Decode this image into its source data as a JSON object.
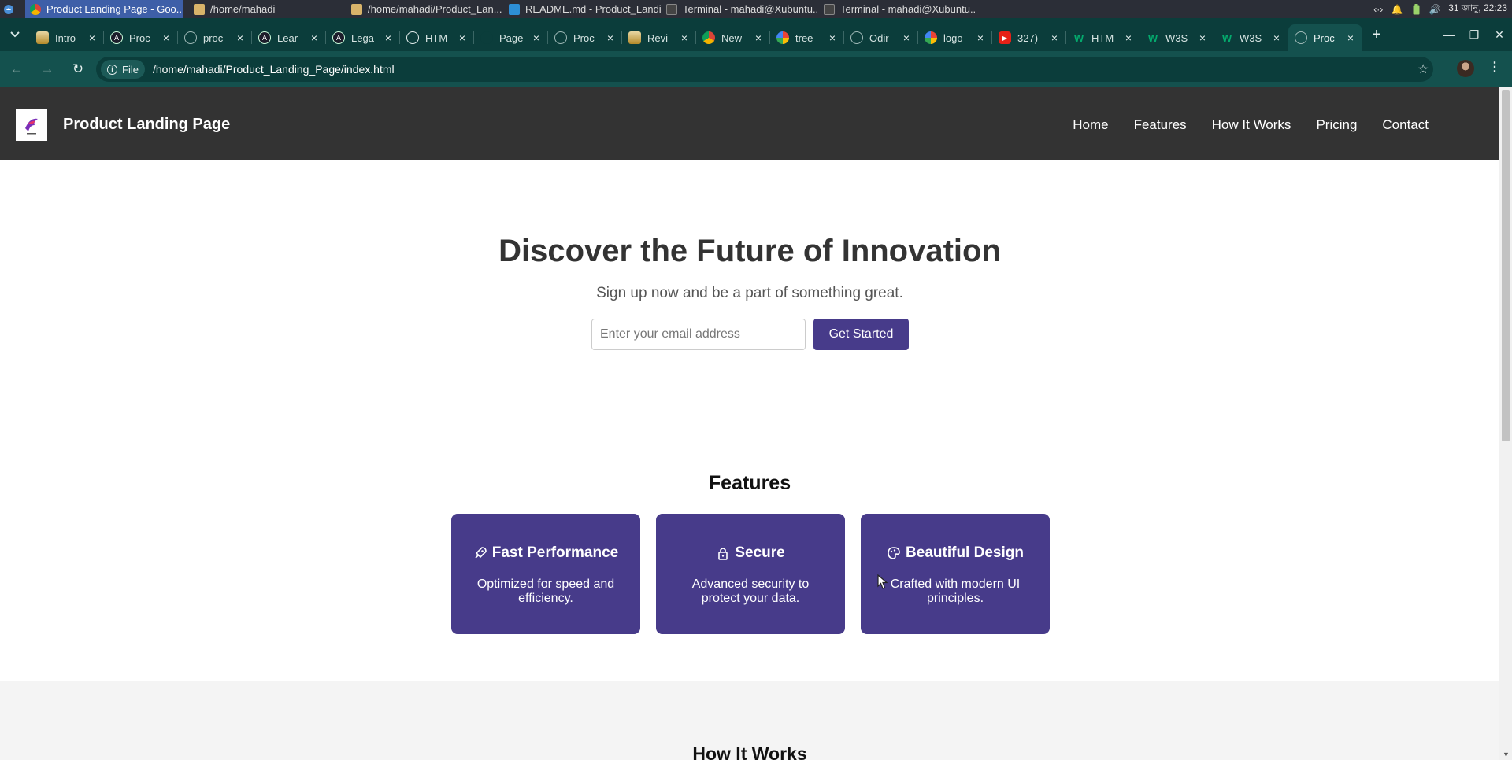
{
  "taskbar": {
    "windows": [
      {
        "label": "Product Landing Page - Goo...",
        "icon": "chrome-icon",
        "active": true
      },
      {
        "label": "/home/mahadi",
        "icon": "folder-icon"
      },
      {
        "label": "/home/mahadi/Product_Lan...",
        "icon": "folder-icon"
      },
      {
        "label": "README.md - Product_Landi...",
        "icon": "vscode-icon"
      },
      {
        "label": "Terminal - mahadi@Xubuntu...",
        "icon": "terminal-icon"
      },
      {
        "label": "Terminal - mahadi@Xubuntu...",
        "icon": "terminal-icon"
      }
    ],
    "clock": "31 জানু, 22:23"
  },
  "tabs": [
    {
      "label": "Intro",
      "icon": "odin-icon",
      "color": "#c9a227"
    },
    {
      "label": "Proc",
      "icon": "angular-icon",
      "color": "#1d1d2b"
    },
    {
      "label": "proc",
      "icon": "globe-icon",
      "color": "#5b7b79"
    },
    {
      "label": "Lear",
      "icon": "angular-icon",
      "color": "#1d1d2b"
    },
    {
      "label": "Lega",
      "icon": "angular-icon",
      "color": "#1d1d2b"
    },
    {
      "label": "HTM",
      "icon": "openai-icon",
      "color": "#1d1d2b"
    },
    {
      "label": "Page",
      "icon": "blank-icon",
      "color": "#0b3d3b"
    },
    {
      "label": "Proc",
      "icon": "globe-icon",
      "color": "#5b7b79"
    },
    {
      "label": "Revi",
      "icon": "odin-icon",
      "color": "#c9a227"
    },
    {
      "label": "New",
      "icon": "chrome-icon",
      "color": "#2f2f2f"
    },
    {
      "label": "tree",
      "icon": "google-icon",
      "color": "#ffffff"
    },
    {
      "label": "Odir",
      "icon": "globe-icon",
      "color": "#5b7b79"
    },
    {
      "label": "logo",
      "icon": "google-icon",
      "color": "#ffffff"
    },
    {
      "label": "327)",
      "icon": "youtube-icon",
      "color": "#e62117"
    },
    {
      "label": "HTM",
      "icon": "w3schools-icon",
      "color": "#04aa6d"
    },
    {
      "label": "W3S",
      "icon": "w3schools-icon",
      "color": "#04aa6d"
    },
    {
      "label": "W3S",
      "icon": "w3schools-icon",
      "color": "#04aa6d"
    },
    {
      "label": "Proc",
      "icon": "globe-icon",
      "color": "#5b7b79",
      "active": true
    }
  ],
  "toolbar": {
    "scheme_chip": "File",
    "url": "/home/mahadi/Product_Landing_Page/index.html"
  },
  "page": {
    "site_title": "Product Landing Page",
    "nav": [
      "Home",
      "Features",
      "How It Works",
      "Pricing",
      "Contact"
    ],
    "hero": {
      "title": "Discover the Future of Innovation",
      "subtitle": "Sign up now and be a part of something great.",
      "email_placeholder": "Enter your email address",
      "cta": "Get Started"
    },
    "features_title": "Features",
    "features": [
      {
        "title": "Fast Performance",
        "icon": "rocket-icon",
        "text": "Optimized for speed and efficiency."
      },
      {
        "title": "Secure",
        "icon": "lock-icon",
        "text": "Advanced security to protect your data."
      },
      {
        "title": "Beautiful Design",
        "icon": "palette-icon",
        "text": "Crafted with modern UI principles."
      }
    ],
    "how_title": "How It Works"
  },
  "colors": {
    "header_bg": "#333333",
    "accent": "#473b8a",
    "browser_frame": "#14514e"
  }
}
